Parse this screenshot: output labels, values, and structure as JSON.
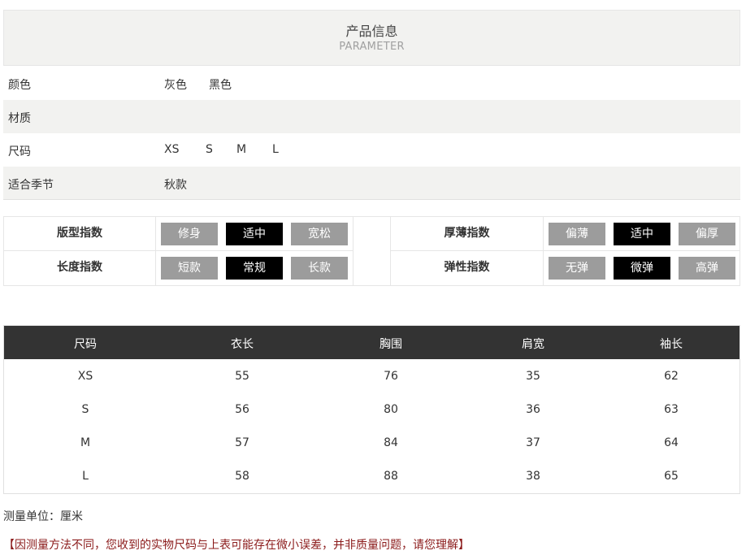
{
  "header": {
    "title": "产品信息",
    "subtitle": "PARAMETER"
  },
  "info": [
    {
      "label": "颜色",
      "values": [
        "灰色",
        "黑色"
      ]
    },
    {
      "label": "材质",
      "values": []
    },
    {
      "label": "尺码",
      "values": [
        "XS",
        "S",
        "M",
        "L"
      ]
    },
    {
      "label": "适合季节",
      "values": [
        "秋款"
      ]
    }
  ],
  "indices": {
    "left": [
      {
        "label": "版型指数",
        "options": [
          "修身",
          "适中",
          "宽松"
        ],
        "selected": "适中"
      },
      {
        "label": "长度指数",
        "options": [
          "短款",
          "常规",
          "长款"
        ],
        "selected": "常规"
      }
    ],
    "right": [
      {
        "label": "厚薄指数",
        "options": [
          "偏薄",
          "适中",
          "偏厚"
        ],
        "selected": "适中"
      },
      {
        "label": "弹性指数",
        "options": [
          "无弹",
          "微弹",
          "高弹"
        ],
        "selected": "微弹"
      }
    ]
  },
  "size_table": {
    "headers": [
      "尺码",
      "衣长",
      "胸围",
      "肩宽",
      "袖长"
    ],
    "rows": [
      [
        "XS",
        "55",
        "76",
        "35",
        "62"
      ],
      [
        "S",
        "56",
        "80",
        "36",
        "63"
      ],
      [
        "M",
        "57",
        "84",
        "37",
        "64"
      ],
      [
        "L",
        "58",
        "88",
        "38",
        "65"
      ]
    ]
  },
  "notes": {
    "unit": "测量单位：厘米",
    "disclaimer": "【因测量方法不同，您收到的实物尺码与上表可能存在微小误差，并非质量问题，请您理解】"
  },
  "colors": {
    "header_bg": "#f2f2f0",
    "table_head_bg": "#333333",
    "chip_on": "#000000",
    "chip_off": "#9c9c9c",
    "note_red": "#8b1a1a"
  }
}
